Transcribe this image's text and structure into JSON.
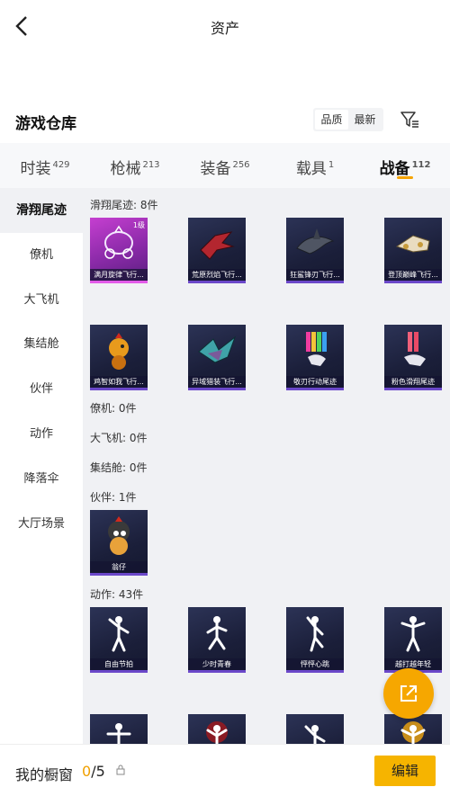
{
  "header": {
    "title": "资产"
  },
  "warehouse": {
    "title": "游戏仓库",
    "sort_options": [
      "品质",
      "最新"
    ]
  },
  "tabs": [
    {
      "label": "时装",
      "count": "429"
    },
    {
      "label": "枪械",
      "count": "213"
    },
    {
      "label": "装备",
      "count": "256"
    },
    {
      "label": "载具",
      "count": "1"
    },
    {
      "label": "战备",
      "count": "112"
    }
  ],
  "sidebar": [
    "滑翔尾迹",
    "僚机",
    "大飞机",
    "集结舱",
    "伙伴",
    "动作",
    "降落伞",
    "大厅场景"
  ],
  "groups": {
    "trail": "滑翔尾迹: 8件",
    "wingman": "僚机: 0件",
    "plane": "大飞机: 0件",
    "capsule": "集结舱: 0件",
    "partner": "伙伴: 1件",
    "action": "动作: 43件"
  },
  "trail_items": [
    {
      "name": "满月旋律飞行...",
      "level": "1级"
    },
    {
      "name": "荒原烈焰飞行..."
    },
    {
      "name": "狂鲨锋刃飞行..."
    },
    {
      "name": "登顶巅峰飞行..."
    },
    {
      "name": "鸡智如我飞行..."
    },
    {
      "name": "异域猎装飞行..."
    },
    {
      "name": "敬刃行动尾迹"
    },
    {
      "name": "粉色滑翔尾迹"
    }
  ],
  "partner_items": [
    {
      "name": "翁仔"
    }
  ],
  "action_items": [
    {
      "name": "自由节拍"
    },
    {
      "name": "少时青春"
    },
    {
      "name": "怦怦心跳"
    },
    {
      "name": "越打越年轻"
    }
  ],
  "bottom": {
    "label": "我的橱窗",
    "current": "0",
    "total": "/5",
    "edit": "编辑"
  },
  "colors": {
    "accent": "#f6b400",
    "rare_border": "#e25be8",
    "epic_border": "#6b48c9"
  }
}
